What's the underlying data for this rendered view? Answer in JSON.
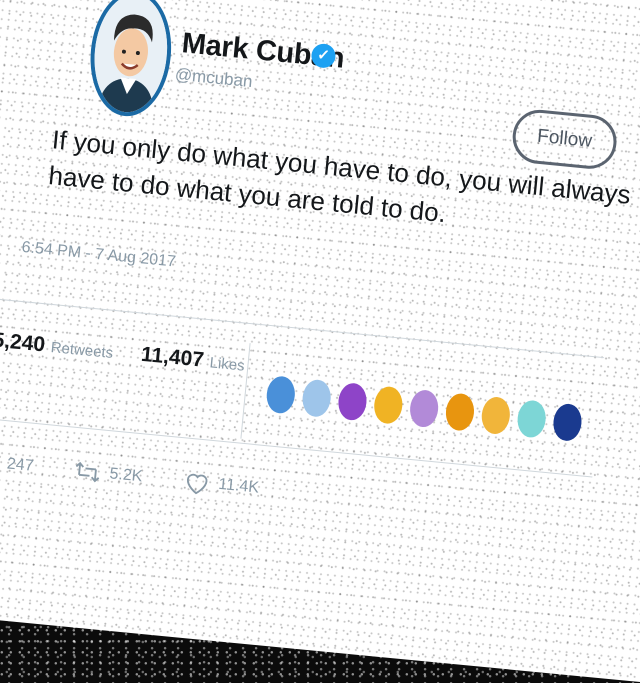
{
  "user": {
    "name": "Mark Cuban",
    "handle": "@mcuban",
    "verified_icon": "verified-badge-icon"
  },
  "follow_label": "Follow",
  "tweet": {
    "text": "If you only do what you have to do, you will always have to do what you are told to do.",
    "timestamp": "6:54 PM - 7 Aug 2017"
  },
  "stats": {
    "retweets_count": "5,240",
    "retweets_label": "Retweets",
    "likes_count": "11,407",
    "likes_label": "Likes"
  },
  "liker_avatar_colors": [
    "#4a90d9",
    "#9ec5ea",
    "#8e44c8",
    "#f0b324",
    "#b28ad8",
    "#e8950f",
    "#f1b53a",
    "#7dd6d6",
    "#1a3a8f"
  ],
  "actions": {
    "replies": "247",
    "retweets": "5.2K",
    "likes": "11.4K"
  },
  "colors": {
    "accent": "#1da1f2",
    "muted_text": "#8899a6",
    "avatar_ring": "#1b6aa5"
  }
}
